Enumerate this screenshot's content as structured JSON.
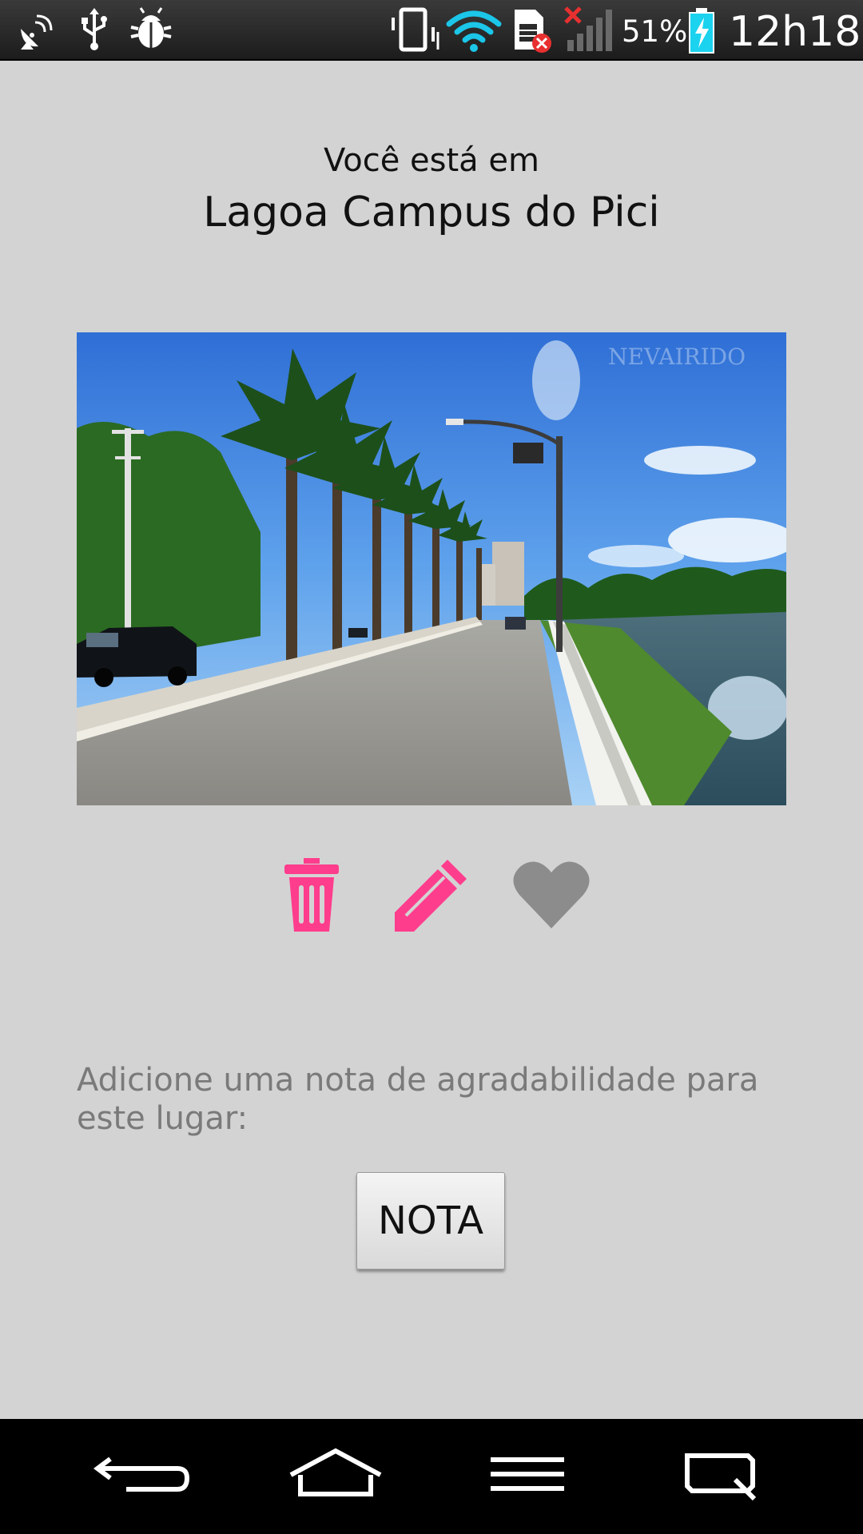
{
  "status_bar": {
    "icons": [
      "satellite-dish-icon",
      "usb-icon",
      "bug-icon",
      "vibrate-icon",
      "wifi-icon",
      "sim-error-icon",
      "signal-none-icon",
      "battery-charging-icon"
    ],
    "battery_percent": "51%",
    "clock": "12h18"
  },
  "header": {
    "subtitle": "Você está em",
    "title": "Lagoa Campus do Pici"
  },
  "photo": {
    "watermark": "NEVAIRIDO"
  },
  "actions": {
    "icons": [
      "trash-icon",
      "pencil-icon",
      "heart-icon"
    ],
    "colors": {
      "primary": "#ff3d8d",
      "inactive": "#8c8c8c"
    }
  },
  "rating": {
    "prompt": "Adicione uma nota de agradabilidade para este lugar:",
    "button_label": "NOTA"
  },
  "nav_bar": {
    "icons": [
      "back-icon",
      "home-icon",
      "menu-icon",
      "qslide-icon"
    ]
  }
}
